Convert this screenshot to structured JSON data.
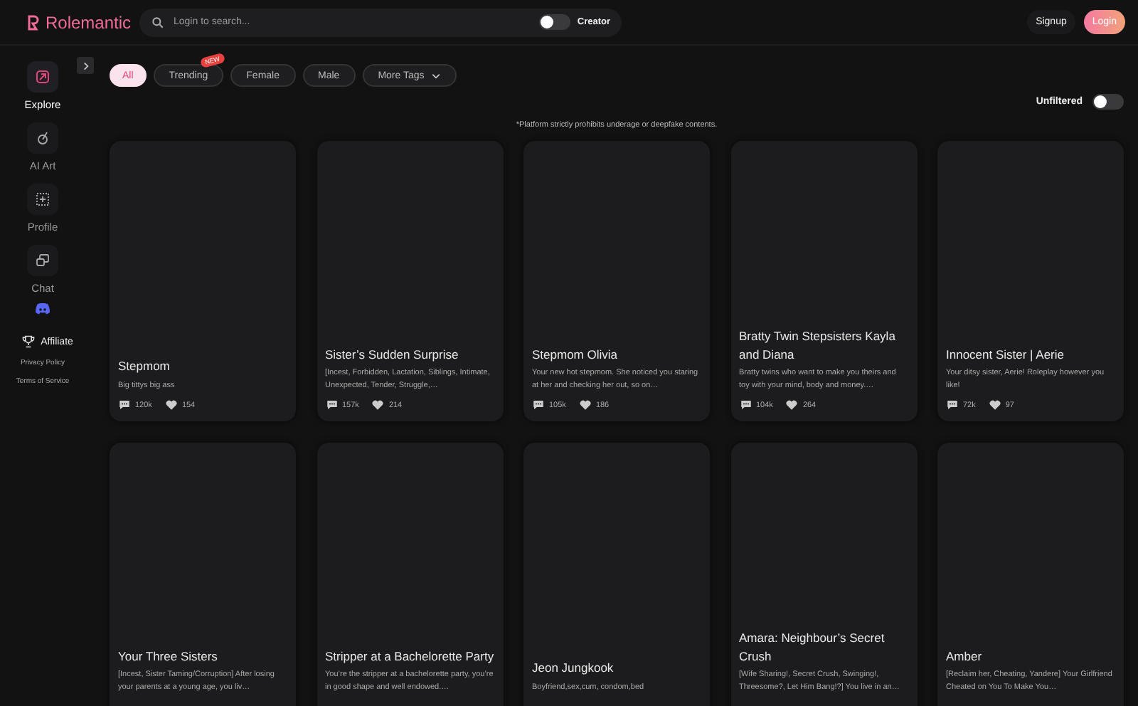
{
  "header": {
    "logo": "Rolemantic",
    "search": {
      "placeholder": "Login to search..."
    },
    "creator_toggle": {
      "label": "Creator",
      "on": false
    },
    "buttons": [
      {
        "label": "Signup",
        "kind": "plain"
      },
      {
        "label": "Login",
        "kind": "primary"
      }
    ]
  },
  "sidebar": {
    "items": [
      {
        "label": "Explore",
        "selected": true
      },
      {
        "label": "AI Art",
        "selected": false
      },
      {
        "label": "Profile",
        "selected": false
      },
      {
        "label": "Chat",
        "selected": false
      }
    ],
    "affiliate": "Affiliate",
    "links": [
      "Privacy Policy",
      "Terms of Service"
    ]
  },
  "tags": [
    {
      "label": "All",
      "selected": true
    },
    {
      "label": "Trending",
      "selected": false,
      "badge": "NEW"
    },
    {
      "label": "Female",
      "selected": false
    },
    {
      "label": "Male",
      "selected": false
    },
    {
      "label": "More Tags",
      "selected": false,
      "dropdown": true
    }
  ],
  "unfiltered_toggle": {
    "label": "Unfiltered",
    "on": false
  },
  "notice": "*Platform strictly prohibits underage or deepfake contents.",
  "cards": [
    {
      "title": "Stepmom",
      "description": "Big tittys big ass",
      "chats": "120k",
      "likes": "154"
    },
    {
      "title": "Sister’s Sudden Surprise",
      "description": "[Incest, Forbidden, Lactation, Siblings, Intimate, Unexpected, Tender, Struggle,…",
      "chats": "157k",
      "likes": "214"
    },
    {
      "title": "Stepmom Olivia",
      "description": "Your new hot stepmom. She noticed you staring at her and checking her out, so on…",
      "chats": "105k",
      "likes": "186"
    },
    {
      "title": "Bratty Twin Stepsisters Kayla and Diana",
      "description": "Bratty twins who want to make you theirs and toy with your mind, body and money.…",
      "chats": "104k",
      "likes": "264"
    },
    {
      "title": "Innocent Sister | Aerie",
      "description": "Your ditsy sister, Aerie! Roleplay however you like!",
      "chats": "72k",
      "likes": "97"
    },
    {
      "title": "Your Three Sisters",
      "description": "[Incest, Sister Taming/Corruption] After losing your parents at a young age, you liv…"
    },
    {
      "title": "Stripper at a Bachelorette Party",
      "description": "You’re the stripper at a bachelorette party, you’re in good shape and well endowed.…"
    },
    {
      "title": "Jeon Jungkook",
      "description": "Boyfriend,sex,cum, condom,bed"
    },
    {
      "title": "Amara: Neighbour’s Secret Crush",
      "description": "[Wife Sharing!, Secret Crush, Swinging!, Threesome?, Let Him Bang!?] You live in an…"
    },
    {
      "title": "Amber",
      "description": "[Reclaim her, Cheating, Yandere] Your Girlfriend Cheated on You To Make You…"
    }
  ]
}
